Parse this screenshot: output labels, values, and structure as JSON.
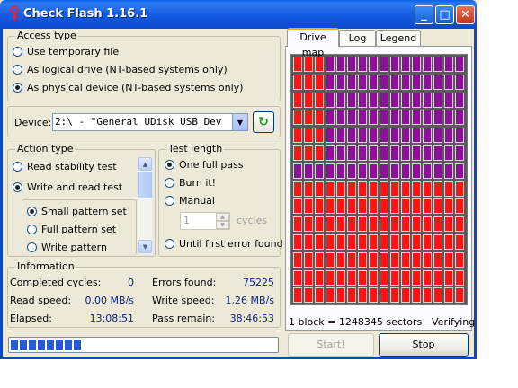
{
  "app": {
    "title": "Check Flash 1.16.1"
  },
  "access_type": {
    "legend": "Access type",
    "options": [
      {
        "label": "Use temporary file",
        "selected": false
      },
      {
        "label": "As logical drive (NT-based systems only)",
        "selected": false
      },
      {
        "label": "As physical device (NT-based systems only)",
        "selected": true
      }
    ]
  },
  "device": {
    "label": "Device:",
    "value": "2:\\ - \"General UDisk USB Dev"
  },
  "action_type": {
    "legend": "Action type",
    "options": [
      {
        "label": "Read stability test",
        "selected": false
      },
      {
        "label": "Write and read test",
        "selected": true
      }
    ],
    "patterns": [
      {
        "label": "Small pattern set",
        "selected": true
      },
      {
        "label": "Full pattern set",
        "selected": false
      },
      {
        "label": "Write pattern",
        "selected": false
      }
    ]
  },
  "test_length": {
    "legend": "Test length",
    "options": [
      {
        "label": "One full pass",
        "selected": true
      },
      {
        "label": "Burn it!",
        "selected": false
      },
      {
        "label": "Manual",
        "selected": false
      },
      {
        "label": "Until first error found",
        "selected": false
      }
    ],
    "cycles_value": "1",
    "cycles_label": "cycles"
  },
  "information": {
    "legend": "Information",
    "completed_cycles_label": "Completed cycles:",
    "completed_cycles_value": "0",
    "errors_found_label": "Errors found:",
    "errors_found_value": "75225",
    "read_speed_label": "Read speed:",
    "read_speed_value": "0,00 MB/s",
    "write_speed_label": "Write speed:",
    "write_speed_value": "1,26 MB/s",
    "elapsed_label": "Elapsed:",
    "elapsed_value": "13:08:51",
    "pass_remain_label": "Pass remain:",
    "pass_remain_value": "38:46:53"
  },
  "progress": {
    "fraction": 0.27
  },
  "tabs": [
    {
      "label": "Drive map",
      "active": true
    },
    {
      "label": "Log",
      "active": false
    },
    {
      "label": "Legend",
      "active": false
    }
  ],
  "drive_map": {
    "block_info": "1 block = 1248345 sectors",
    "status": "Verifying",
    "columns": 16,
    "rows": 14,
    "colors": {
      "red": "#ff1414",
      "purple": "#8e0e9c"
    }
  },
  "buttons": {
    "start": "Start!",
    "stop": "Stop"
  }
}
